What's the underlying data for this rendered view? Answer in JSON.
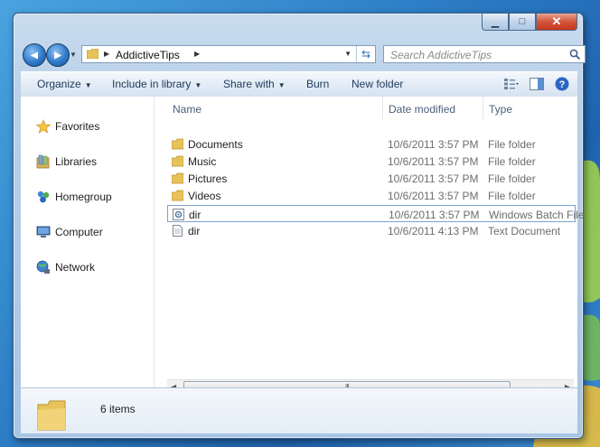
{
  "window": {
    "caption": {
      "minimize": "▁",
      "maximize": "□",
      "close": "✕"
    }
  },
  "navigation": {
    "back_glyph": "◀",
    "forward_glyph": "▶",
    "recent_glyph": "▼",
    "address": {
      "crumb": "AddictiveTips",
      "separator": "▶",
      "dropdown": "▼",
      "refresh_glyph": "⇆"
    },
    "search": {
      "placeholder": "Search AddictiveTips",
      "icon": "magnifier-icon"
    }
  },
  "toolbar": {
    "organize": "Organize",
    "include_in_library": "Include in library",
    "share_with": "Share with",
    "burn": "Burn",
    "new_folder": "New folder",
    "dropdown_glyph": "▼",
    "help_glyph": "?"
  },
  "nav_pane": {
    "items": [
      {
        "label": "Favorites",
        "icon": "star-icon"
      },
      {
        "label": "Libraries",
        "icon": "libraries-icon"
      },
      {
        "label": "Homegroup",
        "icon": "homegroup-icon"
      },
      {
        "label": "Computer",
        "icon": "computer-icon"
      },
      {
        "label": "Network",
        "icon": "network-icon"
      }
    ]
  },
  "file_list": {
    "columns": {
      "name": "Name",
      "date": "Date modified",
      "type": "Type"
    },
    "rows": [
      {
        "name": "Documents",
        "date": "10/6/2011 3:57 PM",
        "type": "File folder",
        "icon": "folder-icon"
      },
      {
        "name": "Music",
        "date": "10/6/2011 3:57 PM",
        "type": "File folder",
        "icon": "folder-icon"
      },
      {
        "name": "Pictures",
        "date": "10/6/2011 3:57 PM",
        "type": "File folder",
        "icon": "folder-icon"
      },
      {
        "name": "Videos",
        "date": "10/6/2011 3:57 PM",
        "type": "File folder",
        "icon": "folder-icon"
      },
      {
        "name": "dir",
        "date": "10/6/2011 3:57 PM",
        "type": "Windows Batch File",
        "icon": "batch-file-icon",
        "selected": true
      },
      {
        "name": "dir",
        "date": "10/6/2011 4:13 PM",
        "type": "Text Document",
        "icon": "text-file-icon"
      }
    ],
    "scroll_grip": "III",
    "scroll_left": "◀",
    "scroll_right": "▶"
  },
  "details": {
    "count": "6 items"
  },
  "colors": {
    "folder": "#e8c35a",
    "selection_border": "#7da2ce",
    "toolbar_text": "#1e395b"
  }
}
